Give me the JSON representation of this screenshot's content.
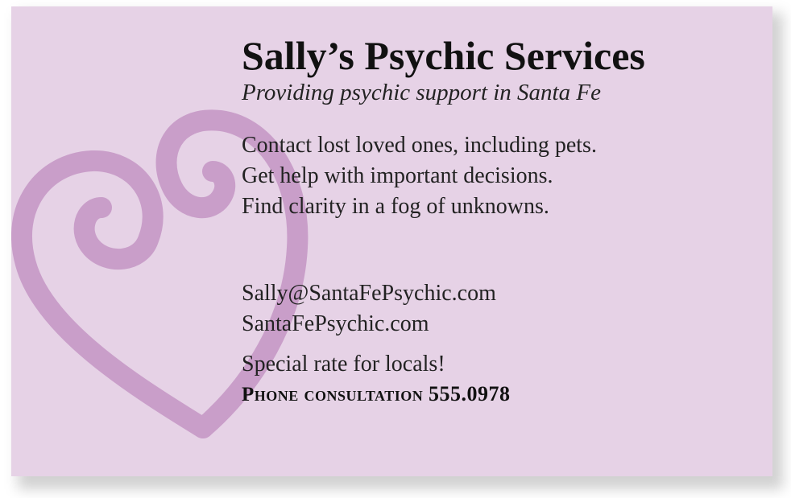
{
  "card": {
    "title": "Sally’s Psychic Services",
    "tagline": "Providing psychic support in Santa Fe",
    "services": [
      "Contact lost loved ones, including pets.",
      "Get help with important decisions.",
      "Find clarity in a fog of unknowns."
    ],
    "email": "Sally@SantaFePsychic.com",
    "website": "SantaFePsychic.com",
    "promo": "Special rate for locals!",
    "phone_label": "Phone consultation",
    "phone_number": "555.0978"
  },
  "colors": {
    "card_background": "#e6d2e6",
    "heart": "#c99ec9",
    "text": "#1a1a1a"
  },
  "icons": {
    "background_graphic": "swirl-heart-icon"
  }
}
